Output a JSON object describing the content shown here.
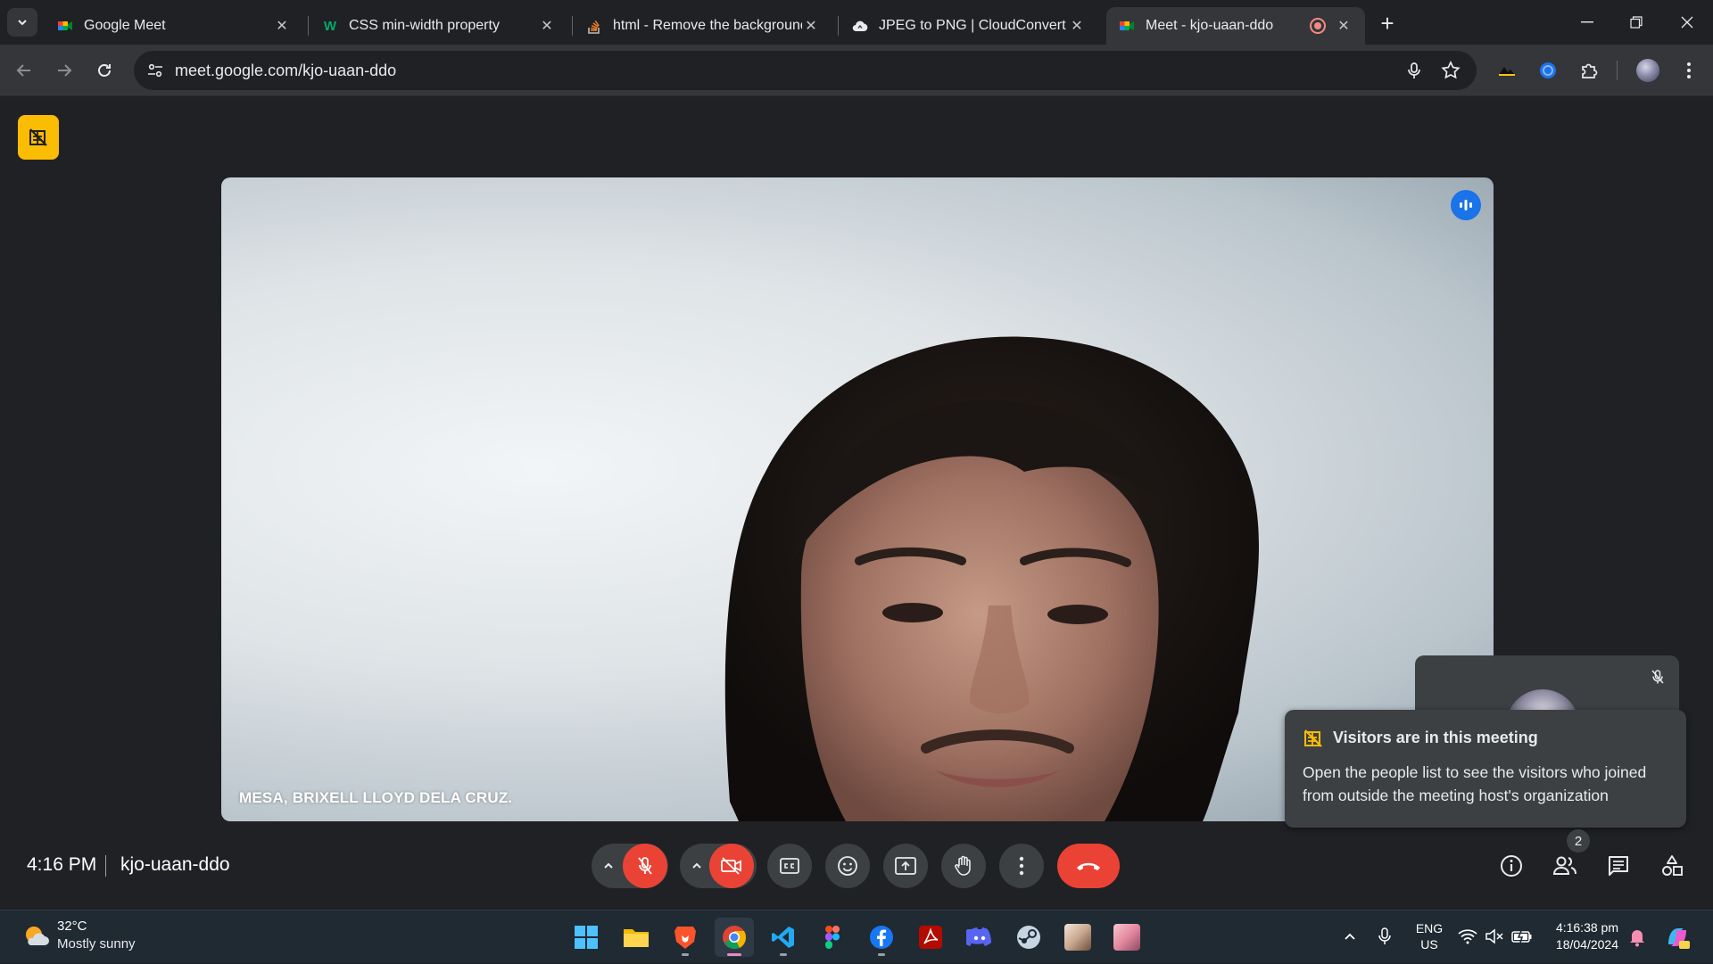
{
  "browser": {
    "tabs": [
      {
        "title": "Google Meet",
        "icon": "google-meet-icon"
      },
      {
        "title": "CSS min-width property",
        "icon": "w3schools-icon"
      },
      {
        "title": "html - Remove the background",
        "icon": "stackoverflow-icon"
      },
      {
        "title": "JPEG to PNG | CloudConvert",
        "icon": "cloudconvert-icon"
      },
      {
        "title": "Meet - kjo-uaan-ddo",
        "icon": "google-meet-icon",
        "active": true,
        "recording": true
      }
    ],
    "url": "meet.google.com/kjo-uaan-ddo"
  },
  "meet": {
    "participant_name": "MESA, BRIXELL LLOYD DELA CRUZ.",
    "toast": {
      "title": "Visitors are in this meeting",
      "body": "Open the people list to see the visitors who joined from outside the meeting host's organization"
    },
    "time": "4:16 PM",
    "meeting_code": "kjo-uaan-ddo",
    "people_count": "2",
    "colors": {
      "accent": "#1a73e8",
      "danger": "#ea4335",
      "warning": "#fbbc04",
      "surface": "#3c4043"
    }
  },
  "taskbar": {
    "weather_temp": "32°C",
    "weather_desc": "Mostly sunny",
    "lang_top": "ENG",
    "lang_bottom": "US",
    "clock_time": "4:16:38 pm",
    "clock_date": "18/04/2024"
  }
}
